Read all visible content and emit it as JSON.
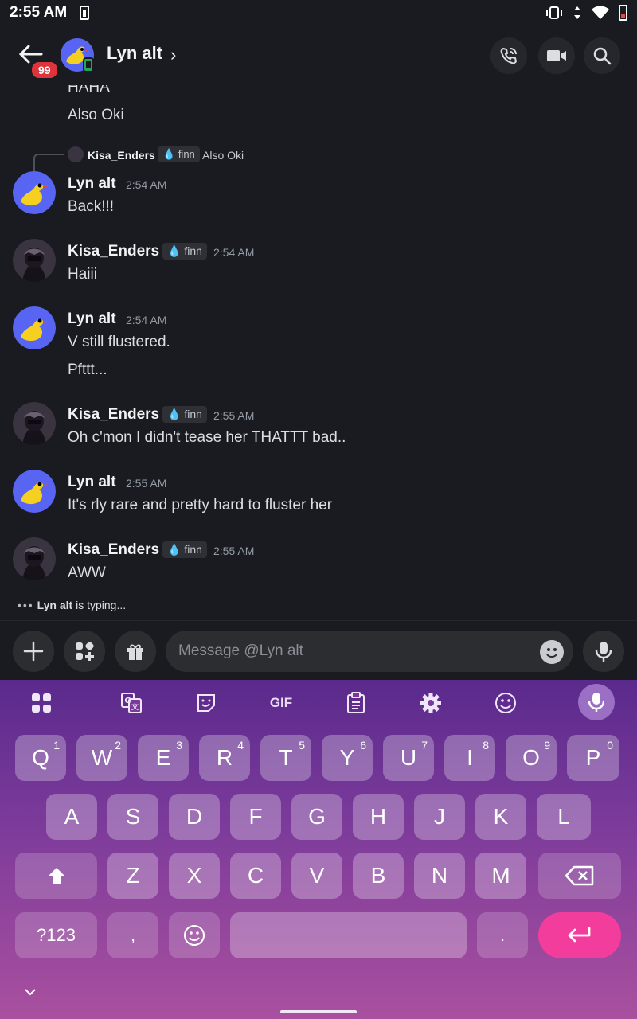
{
  "status_bar": {
    "time": "2:55 AM"
  },
  "header": {
    "badge_count": "99",
    "title": "Lyn alt",
    "chevron": "›"
  },
  "messages": {
    "prev_lines": [
      "HAHA",
      "Also Oki"
    ],
    "reply": {
      "user": "Kisa_Enders",
      "tag": "finn",
      "text": "Also Oki"
    },
    "items": [
      {
        "user": "Lyn alt",
        "tag": "",
        "time": "2:54 AM",
        "lines": [
          "Back!!!"
        ]
      },
      {
        "user": "Kisa_Enders",
        "tag": "finn",
        "time": "2:54 AM",
        "lines": [
          "Haiii"
        ]
      },
      {
        "user": "Lyn alt",
        "tag": "",
        "time": "2:54 AM",
        "lines": [
          "V still flustered.",
          "Pfttt..."
        ]
      },
      {
        "user": "Kisa_Enders",
        "tag": "finn",
        "time": "2:55 AM",
        "lines": [
          "Oh c'mon I didn't tease her THATTT bad.."
        ]
      },
      {
        "user": "Lyn alt",
        "tag": "",
        "time": "2:55 AM",
        "lines": [
          "It's rly rare and pretty hard to fluster her"
        ]
      },
      {
        "user": "Kisa_Enders",
        "tag": "finn",
        "time": "2:55 AM",
        "lines": [
          "AWW"
        ]
      }
    ],
    "typing_user": "Lyn alt",
    "typing_suffix": "is typing..."
  },
  "input": {
    "placeholder": "Message @Lyn alt"
  },
  "keyboard": {
    "gif_label": "GIF",
    "row1": [
      {
        "k": "Q",
        "n": "1"
      },
      {
        "k": "W",
        "n": "2"
      },
      {
        "k": "E",
        "n": "3"
      },
      {
        "k": "R",
        "n": "4"
      },
      {
        "k": "T",
        "n": "5"
      },
      {
        "k": "Y",
        "n": "6"
      },
      {
        "k": "U",
        "n": "7"
      },
      {
        "k": "I",
        "n": "8"
      },
      {
        "k": "O",
        "n": "9"
      },
      {
        "k": "P",
        "n": "0"
      }
    ],
    "row2": [
      "A",
      "S",
      "D",
      "F",
      "G",
      "H",
      "J",
      "K",
      "L"
    ],
    "row3": [
      "Z",
      "X",
      "C",
      "V",
      "B",
      "N",
      "M"
    ],
    "sym_label": "?123",
    "comma": ",",
    "period": "."
  }
}
